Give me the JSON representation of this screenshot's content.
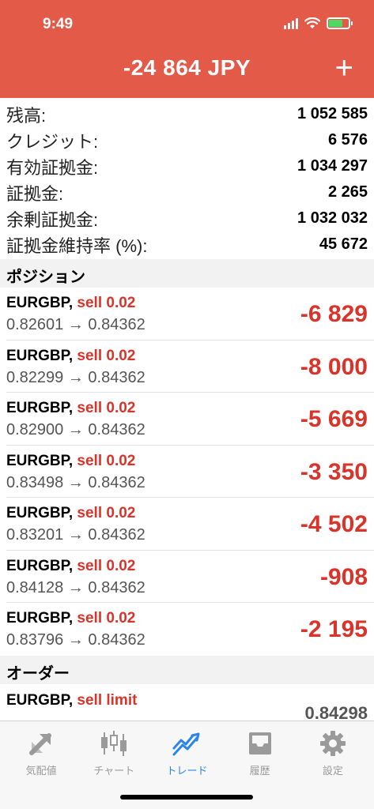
{
  "status_bar": {
    "time": "9:49"
  },
  "header": {
    "title": "-24 864 JPY",
    "add_label": "+"
  },
  "account": [
    {
      "label": "残高:",
      "value": "1 052 585"
    },
    {
      "label": "クレジット:",
      "value": "6 576"
    },
    {
      "label": "有効証拠金:",
      "value": "1 034 297"
    },
    {
      "label": "証拠金:",
      "value": "2 265"
    },
    {
      "label": "余剰証拠金:",
      "value": "1 032 032"
    },
    {
      "label": "証拠金維持率 (%):",
      "value": "45 672"
    }
  ],
  "positions_title": "ポジション",
  "positions": [
    {
      "symbol": "EURGBP,",
      "side": "sell 0.02",
      "prices": "0.82601 → 0.84362",
      "profit": "-6 829"
    },
    {
      "symbol": "EURGBP,",
      "side": "sell 0.02",
      "prices": "0.82299 → 0.84362",
      "profit": "-8 000"
    },
    {
      "symbol": "EURGBP,",
      "side": "sell 0.02",
      "prices": "0.82900 → 0.84362",
      "profit": "-5 669"
    },
    {
      "symbol": "EURGBP,",
      "side": "sell 0.02",
      "prices": "0.83498 → 0.84362",
      "profit": "-3 350"
    },
    {
      "symbol": "EURGBP,",
      "side": "sell 0.02",
      "prices": "0.83201 → 0.84362",
      "profit": "-4 502"
    },
    {
      "symbol": "EURGBP,",
      "side": "sell 0.02",
      "prices": "0.84128 → 0.84362",
      "profit": "-908"
    },
    {
      "symbol": "EURGBP,",
      "side": "sell 0.02",
      "prices": "0.83796 → 0.84362",
      "profit": "-2 195"
    }
  ],
  "orders_title": "オーダー",
  "orders": [
    {
      "symbol": "EURGBP,",
      "side": "sell limit",
      "price": "0.84298"
    }
  ],
  "tabs": [
    {
      "label": "気配値",
      "icon": "quotes-arrow-icon",
      "active": false
    },
    {
      "label": "チャート",
      "icon": "candlestick-chart-icon",
      "active": false
    },
    {
      "label": "トレード",
      "icon": "trade-trend-icon",
      "active": true
    },
    {
      "label": "履歴",
      "icon": "history-inbox-icon",
      "active": false
    },
    {
      "label": "設定",
      "icon": "gear-icon",
      "active": false
    }
  ],
  "colors": {
    "header": "#e35a48",
    "loss": "#d9332a",
    "active_tab": "#2a86e8",
    "inactive_tab": "#9a9a9a"
  }
}
